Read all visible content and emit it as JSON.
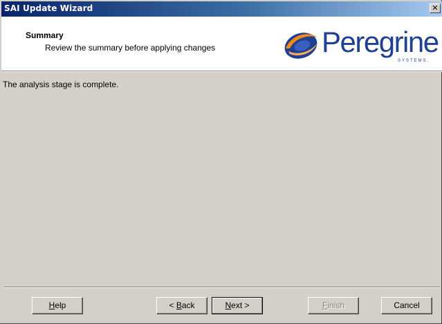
{
  "window": {
    "title": "SAI Update Wizard",
    "close_glyph": "✕"
  },
  "header": {
    "title": "Summary",
    "subtitle": "Review the summary before applying changes",
    "logo_text": "Peregrine",
    "logo_subtext": "SYSTEMS.",
    "logo_icon": "peregrine-swirl-icon"
  },
  "main": {
    "status": "The analysis stage is complete."
  },
  "buttons": {
    "help": {
      "mnemonic": "H",
      "rest": "elp"
    },
    "back": {
      "prefix": "< ",
      "mnemonic": "B",
      "rest": "ack"
    },
    "next": {
      "mnemonic": "N",
      "rest": "ext >"
    },
    "finish": {
      "mnemonic": "F",
      "rest": "inish",
      "disabled": true
    },
    "cancel": {
      "label": "Cancel"
    }
  },
  "colors": {
    "titlebar_start": "#0a246a",
    "titlebar_end": "#a6caf0",
    "face": "#d4d0c8",
    "logo_blue": "#1f3f93",
    "logo_orange": "#f08a1c"
  }
}
